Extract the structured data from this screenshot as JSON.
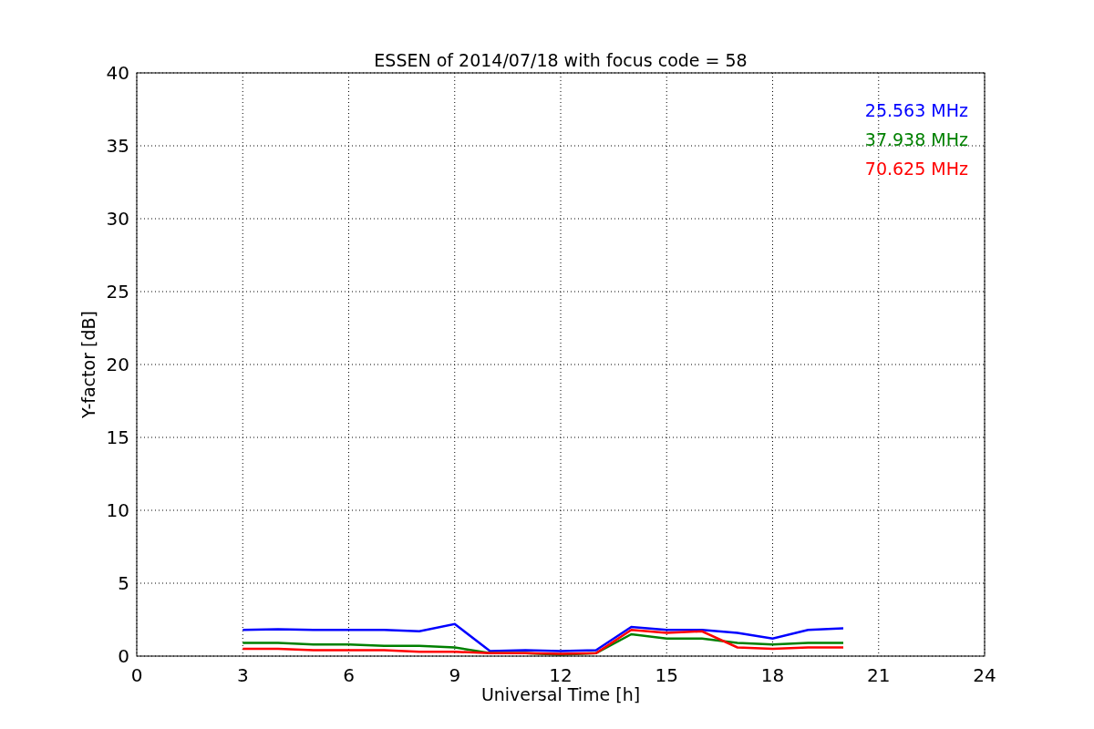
{
  "chart_data": {
    "type": "line",
    "title": "ESSEN of 2014/07/18 with focus code = 58",
    "xlabel": "Universal Time [h]",
    "ylabel": "Y-factor [dB]",
    "x": [
      3,
      4,
      5,
      6,
      7,
      8,
      9,
      10,
      11,
      12,
      13,
      14,
      15,
      16,
      17,
      18,
      19,
      20
    ],
    "series": [
      {
        "name": "25.563 MHz",
        "color": "#0000ff",
        "values": [
          1.8,
          1.85,
          1.8,
          1.8,
          1.8,
          1.7,
          2.2,
          0.35,
          0.4,
          0.35,
          0.4,
          2.0,
          1.8,
          1.8,
          1.6,
          1.2,
          1.8,
          1.9
        ]
      },
      {
        "name": "37.938 MHz",
        "color": "#008000",
        "values": [
          0.9,
          0.9,
          0.8,
          0.8,
          0.7,
          0.7,
          0.6,
          0.2,
          0.2,
          0.1,
          0.2,
          1.5,
          1.2,
          1.2,
          0.9,
          0.8,
          0.9,
          0.9
        ]
      },
      {
        "name": "70.625 MHz",
        "color": "#ff0000",
        "values": [
          0.5,
          0.5,
          0.4,
          0.4,
          0.4,
          0.3,
          0.3,
          0.2,
          0.2,
          0.15,
          0.2,
          1.8,
          1.6,
          1.7,
          0.6,
          0.5,
          0.6,
          0.6
        ]
      }
    ],
    "xlim": [
      0,
      24
    ],
    "ylim": [
      0,
      40
    ],
    "xticks": [
      0,
      3,
      6,
      9,
      12,
      15,
      18,
      21,
      24
    ],
    "yticks": [
      0,
      5,
      10,
      15,
      20,
      25,
      30,
      35,
      40
    ],
    "grid": true
  }
}
